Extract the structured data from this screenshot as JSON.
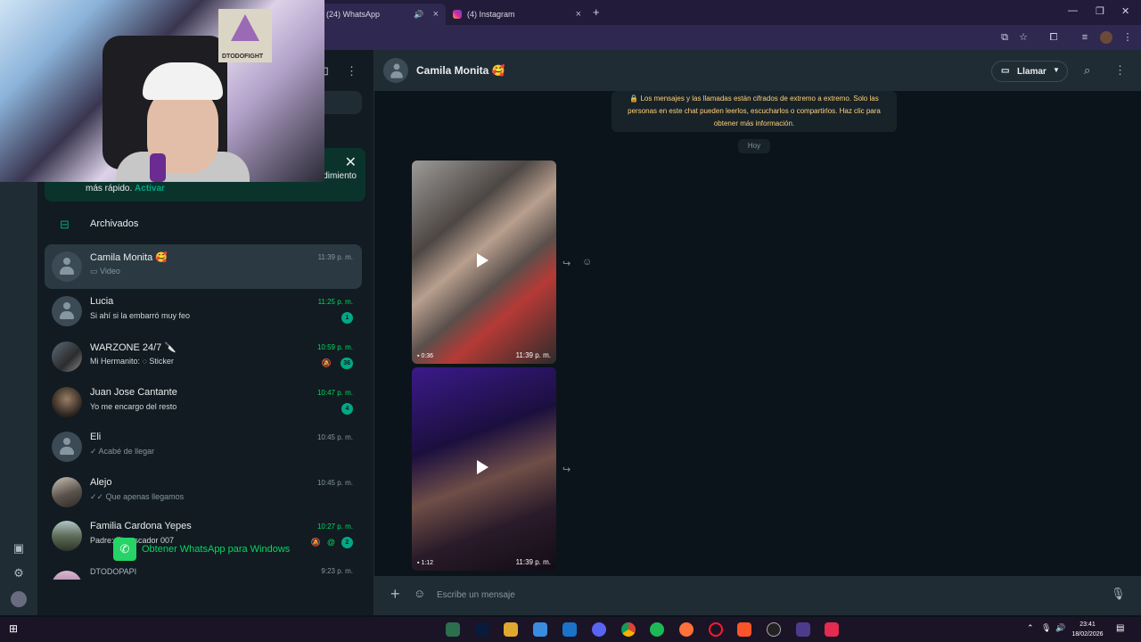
{
  "browser": {
    "tabs": [
      {
        "label": "(24) WhatsApp",
        "active": true
      },
      {
        "label": "(4) Instagram",
        "active": false
      }
    ],
    "new_tab_icon": "plus-icon"
  },
  "webcam": {
    "poster_text": "DTODOFIGHT"
  },
  "sidebar": {
    "notice": {
      "text_line1_tail": "dimiento",
      "text_prefix": "más rápido.",
      "action": "Activar"
    },
    "archived_label": "Archivados",
    "chats": [
      {
        "name": "Camila Monita 🥰",
        "preview": "Video",
        "time": "11:39 p. m.",
        "selected": true
      },
      {
        "name": "Lucia",
        "preview": "Si ahí si la embarró muy feo",
        "time": "11:25 p. m.",
        "badge": "1"
      },
      {
        "name": "WARZONE 24/7 🔪",
        "preview": "Mi Hermanito: ◌ Sticker",
        "time": "10:59 p. m.",
        "badge": "36"
      },
      {
        "name": "Juan Jose Cantante",
        "preview": "Yo me encargo del resto",
        "time": "10:47 p. m.",
        "badge": "4"
      },
      {
        "name": "Eli",
        "preview": "✓ Acabé de llegar",
        "time": "10:45 p. m."
      },
      {
        "name": "Alejo",
        "preview": "✓✓ Que apenas llegamos",
        "time": "10:45 p. m."
      },
      {
        "name": "Familia Cardona Yepes",
        "preview": "Padre: El pescador 007",
        "time": "10:27 p. m.",
        "badge": "2"
      },
      {
        "name": "DTODOPAPI",
        "preview": "",
        "time": "9:23 p. m."
      }
    ],
    "get_app_label": "Obtener WhatsApp para Windows"
  },
  "conversation": {
    "title": "Camila Monita 🥰",
    "call_label": "Llamar",
    "encryption_notice": "🔒 Los mensajes y las llamadas están cifrados de extremo a extremo. Solo las personas en este chat pueden leerlos, escucharlos o compartirlos. Haz clic para obtener más información.",
    "day_label": "Hoy",
    "messages": [
      {
        "type": "video",
        "duration": "0:36",
        "time": "11:39 p. m."
      },
      {
        "type": "video",
        "duration": "1:12",
        "time": "11:39 p. m."
      }
    ],
    "composer_placeholder": "Escribe un mensaje"
  },
  "taskbar": {
    "time": "23:41",
    "date": "18/02/2026"
  },
  "colors": {
    "accent": "#00a884",
    "unread": "#00d95f",
    "panel": "#111b21",
    "header": "#202c33"
  }
}
